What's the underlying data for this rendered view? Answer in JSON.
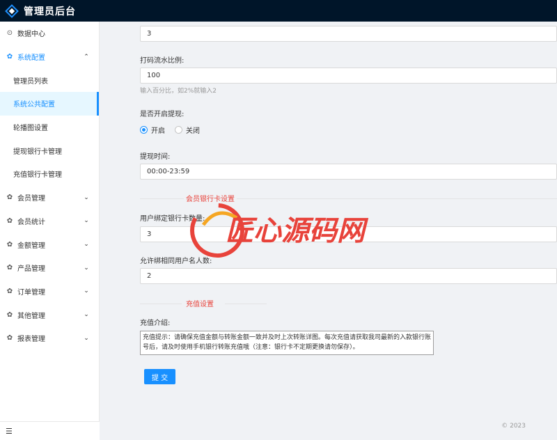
{
  "app": {
    "title": "管理员后台"
  },
  "sidebar": {
    "items": [
      {
        "label": "数据中心",
        "icon": "dashboard-icon",
        "type": "item"
      },
      {
        "label": "系统配置",
        "icon": "gear-icon",
        "type": "group",
        "expanded": true,
        "children": [
          {
            "label": "管理员列表"
          },
          {
            "label": "系统公共配置",
            "active": true
          },
          {
            "label": "轮播图设置"
          },
          {
            "label": "提现银行卡管理"
          },
          {
            "label": "充值银行卡管理"
          }
        ]
      },
      {
        "label": "会员管理",
        "icon": "gear-icon",
        "type": "group"
      },
      {
        "label": "会员统计",
        "icon": "gear-icon",
        "type": "group"
      },
      {
        "label": "金额管理",
        "icon": "gear-icon",
        "type": "group"
      },
      {
        "label": "产品管理",
        "icon": "gear-icon",
        "type": "group"
      },
      {
        "label": "订单管理",
        "icon": "gear-icon",
        "type": "group"
      },
      {
        "label": "其他管理",
        "icon": "gear-icon",
        "type": "group"
      },
      {
        "label": "报表管理",
        "icon": "gear-icon",
        "type": "group"
      }
    ],
    "collapse_icon": "menu-fold-icon"
  },
  "form": {
    "top_value": "3",
    "code_ratio": {
      "label": "打码流水比例:",
      "value": "100",
      "help": "输入百分比，如2%就输入2"
    },
    "withdraw_enabled": {
      "label": "是否开启提现:",
      "options": [
        "开启",
        "关闭"
      ],
      "selected": "开启"
    },
    "withdraw_time": {
      "label": "提现时间:",
      "value": "00:00-23:59"
    },
    "section_member_bank": "会员银行卡设置",
    "bind_count": {
      "label": "用户绑定银行卡数量:",
      "value": "3"
    },
    "same_name": {
      "label": "允许绑相同用户名人数:",
      "value": "2"
    },
    "section_recharge": "充值设置",
    "recharge_intro": {
      "label": "充值介绍:",
      "value": "充值提示：请确保充值金额与转账金额一致并及时上次转账详图。每次充值请获取我司最新的入款银行账号后，请及时使用手机银行转账充值哦（注意：银行卡不定期更换请勿保存）。"
    },
    "submit_label": "提 交"
  },
  "footer": {
    "copyright": "© 2023"
  },
  "watermark": {
    "text": "匠心源码网"
  },
  "colors": {
    "primary": "#1890ff",
    "header_bg": "#001529",
    "section_title": "#e8433b"
  }
}
